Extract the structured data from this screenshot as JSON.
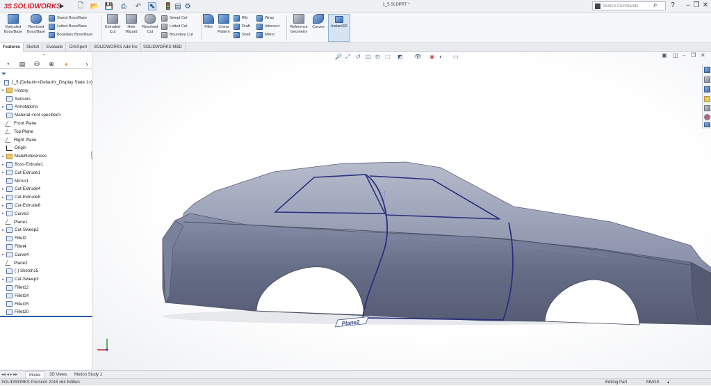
{
  "app": {
    "brand": "SOLIDWORKS",
    "brand_prefix": "3S",
    "doc_title": "1_5.SLDPRT *"
  },
  "search": {
    "placeholder": "Search Commands"
  },
  "ribbon": {
    "extruded_boss": "Extruded Boss/Base",
    "revolved_boss": "Revolved Boss/Base",
    "swept_boss": "Swept Boss/Base",
    "lofted_boss": "Lofted Boss/Base",
    "boundary_boss": "Boundary Boss/Base",
    "extruded_cut": "Extruded Cut",
    "hole_wizard": "Hole Wizard",
    "revolved_cut": "Revolved Cut",
    "swept_cut": "Swept Cut",
    "lofted_cut": "Lofted Cut",
    "boundary_cut": "Boundary Cut",
    "fillet": "Fillet",
    "linear_pattern": "Linear Pattern",
    "rib": "Rib",
    "draft": "Draft",
    "shell": "Shell",
    "wrap": "Wrap",
    "intersect": "Intersect",
    "mirror": "Mirror",
    "reference_geometry": "Reference Geometry",
    "curves": "Curves",
    "instant3d": "Instant3D"
  },
  "tabs": [
    "Features",
    "Sketch",
    "Evaluate",
    "DimXpert",
    "SOLIDWORKS Add-Ins",
    "SOLIDWORKS MBD"
  ],
  "tree": [
    {
      "label": "1_5  (Default<<Default>_Display State 1>)",
      "icon": "part",
      "expand": false
    },
    {
      "label": "History",
      "icon": "folder",
      "expand": true
    },
    {
      "label": "Sensors",
      "icon": "sensor",
      "expand": false
    },
    {
      "label": "Annotations",
      "icon": "annotation",
      "expand": true
    },
    {
      "label": "Material <not specified>",
      "icon": "material",
      "expand": false
    },
    {
      "label": "Front Plane",
      "icon": "plane",
      "expand": false
    },
    {
      "label": "Top Plane",
      "icon": "plane",
      "expand": false
    },
    {
      "label": "Right Plane",
      "icon": "plane",
      "expand": false
    },
    {
      "label": "Origin",
      "icon": "origin",
      "expand": false
    },
    {
      "label": "MateReferences",
      "icon": "folder",
      "expand": true
    },
    {
      "label": "Boss-Extrude1",
      "icon": "feature",
      "expand": true
    },
    {
      "label": "Cut-Extrude1",
      "icon": "feature",
      "expand": true
    },
    {
      "label": "Mirror1",
      "icon": "feature",
      "expand": false
    },
    {
      "label": "Cut-Extrude4",
      "icon": "feature",
      "expand": true
    },
    {
      "label": "Cut-Extrude5",
      "icon": "feature",
      "expand": true
    },
    {
      "label": "Cut-Extrude8",
      "icon": "feature",
      "expand": true
    },
    {
      "label": "Curve3",
      "icon": "curve",
      "expand": true
    },
    {
      "label": "Plane1",
      "icon": "plane",
      "expand": false
    },
    {
      "label": "Cut-Sweep2",
      "icon": "feature",
      "expand": true
    },
    {
      "label": "Fillet2",
      "icon": "feature",
      "expand": false
    },
    {
      "label": "Fillet4",
      "icon": "feature",
      "expand": false
    },
    {
      "label": "Curve4",
      "icon": "curve",
      "expand": true
    },
    {
      "label": "Plane2",
      "icon": "plane",
      "expand": false
    },
    {
      "label": "(-) Sketch15",
      "icon": "sketch",
      "expand": false
    },
    {
      "label": "Cut-Sweep3",
      "icon": "feature",
      "expand": true
    },
    {
      "label": "Fillet12",
      "icon": "feature",
      "expand": false
    },
    {
      "label": "Fillet14",
      "icon": "feature",
      "expand": false
    },
    {
      "label": "Fillet15",
      "icon": "feature",
      "expand": false
    },
    {
      "label": "Fillet20",
      "icon": "feature",
      "expand": false
    }
  ],
  "viewport": {
    "plane_label": "Plane2"
  },
  "bottom_tabs": [
    "Model",
    "3D Views",
    "Motion Study 1"
  ],
  "status": {
    "edition": "SOLIDWORKS Premium 2016 x64 Edition",
    "mode": "Editing Part",
    "units": "MMGS"
  },
  "colors": {
    "body": "#5f6680",
    "curve": "#2a2f7e",
    "accent": "#c8202f"
  }
}
